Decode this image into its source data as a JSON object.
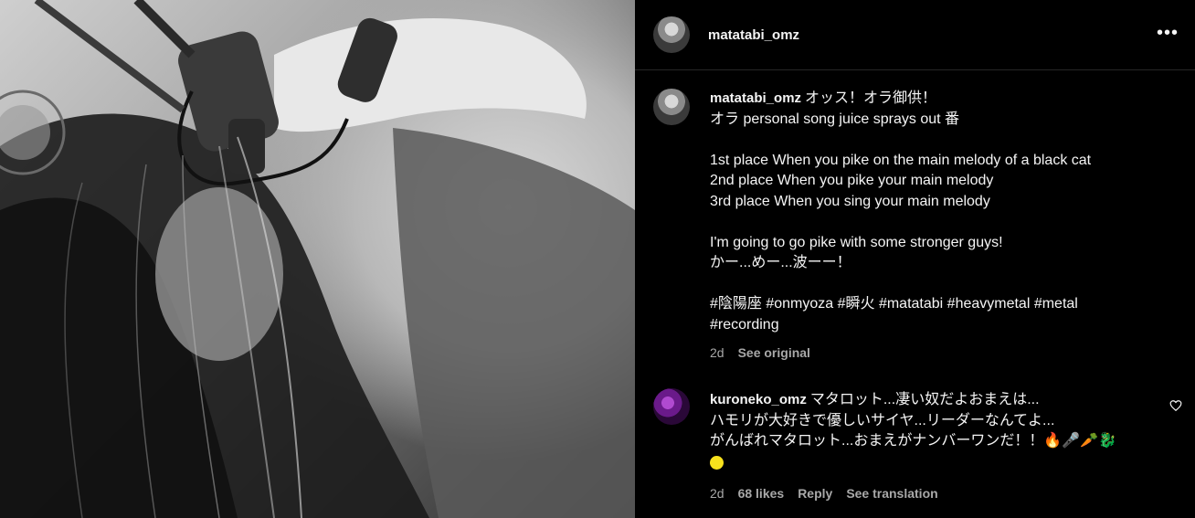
{
  "post": {
    "author": "matatabi_omz",
    "menu_icon": "more-horizontal-icon"
  },
  "caption": {
    "author": "matatabi_omz",
    "lines": [
      "オッス！オラ御供！",
      "オラ personal song juice sprays out 番",
      "",
      "1st place When you pike on the main melody of a black cat",
      "2nd place When you pike your main melody",
      "3rd place When you sing your main melody",
      "",
      "I'm going to go pike with some stronger guys!",
      "かー...めー...波ーー！",
      "",
      "#陰陽座 #onmyoza #瞬火 #matatabi #heavymetal #metal",
      "#recording"
    ],
    "age": "2d",
    "see_original": "See original"
  },
  "comment": {
    "author": "kuroneko_omz",
    "lines": [
      "マタロット...凄い奴だよおまえは...",
      "ハモリが大好きで優しいサイヤ...リーダーなんてよ...",
      "がんばれマタロット...おまえがナンバーワンだ！！🔥🎤🥕🐉"
    ],
    "age": "2d",
    "likes": "68 likes",
    "reply": "Reply",
    "see_translation": "See translation",
    "like_icon": "heart-outline-icon"
  },
  "colors": {
    "background": "#000000",
    "text": "#f5f5f5",
    "secondary_text": "#a8a8a8",
    "divider": "#262626"
  }
}
